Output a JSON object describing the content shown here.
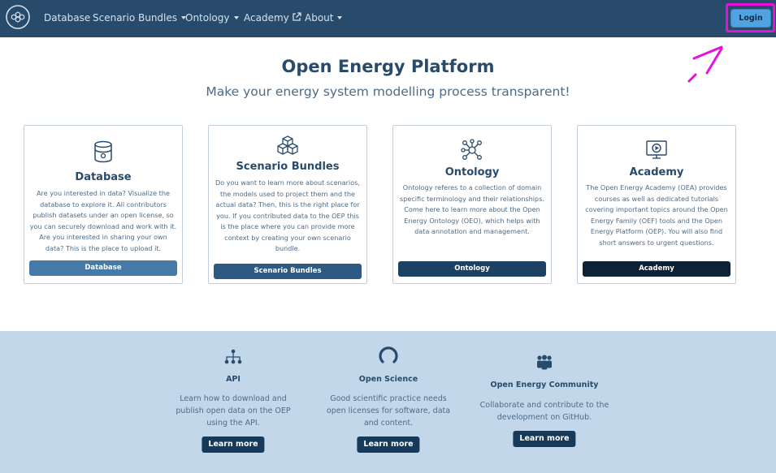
{
  "nav": {
    "logo_icon": "oep-hexagon-logo",
    "items": [
      {
        "label": "Database",
        "dropdown": false
      },
      {
        "label": "Scenario Bundles",
        "dropdown": true
      },
      {
        "label": "Ontology",
        "dropdown": true
      },
      {
        "label": "Academy",
        "external": true
      },
      {
        "label": "About",
        "dropdown": true
      }
    ],
    "login_label": "Login"
  },
  "hero": {
    "title": "Open Energy Platform",
    "subtitle": "Make your energy system modelling process transparent!"
  },
  "cards": [
    {
      "icon": "database-icon",
      "title": "Database",
      "text": "Are you interested in data? Visualize the database to explore it. All contributors publish datasets under an open license, so you can securely download and work with it. Are you interested in sharing your own data? This is the place to upload it.",
      "button": "Database",
      "button_color": "#4479a8"
    },
    {
      "icon": "boxes-icon",
      "title": "Scenario Bundles",
      "text": "Do you want to learn more about scenarios, the models used to project them and the actual data? Then, this is the right place for you. If you contributed data to the OEP this is the place where you can provide more context by creating your own scenario bundle.",
      "button": "Scenario Bundles",
      "button_color": "#2d5a82"
    },
    {
      "icon": "network-icon",
      "title": "Ontology",
      "text": "Ontology referes to a collection of domain specific terminology and their relationships. Come here to learn more about the Open Energy Ontology (OEO), which helps with data annotation and management.",
      "button": "Ontology",
      "button_color": "#1c4163"
    },
    {
      "icon": "video-icon",
      "title": "Academy",
      "text": "The Open Energy Academy (OEA) provides courses as well as dedicated tutorials covering important topics around the Open Energy Family (OEF) tools and the Open Energy Platform (OEP). You will also find short answers to urgent questions.",
      "button": "Academy",
      "button_color": "#0d2236"
    }
  ],
  "features": [
    {
      "icon": "sitemap-icon",
      "title": "API",
      "text": "Learn how to download and publish open data on the OEP using the API.",
      "button": "Learn more"
    },
    {
      "icon": "open-access-icon",
      "title": "Open Science",
      "text": "Good scientific practice needs open licenses for software, data and content.",
      "button": "Learn more"
    },
    {
      "icon": "community-icon",
      "title": "Open Energy Community",
      "text": "Collaborate and contribute to the development on GitHub.",
      "button": "Learn more"
    }
  ],
  "colors": {
    "navbar": "#294b6b",
    "login_button": "#51a2e0",
    "annotation": "#e612d9",
    "bottom_band": "#c2d7ea"
  }
}
